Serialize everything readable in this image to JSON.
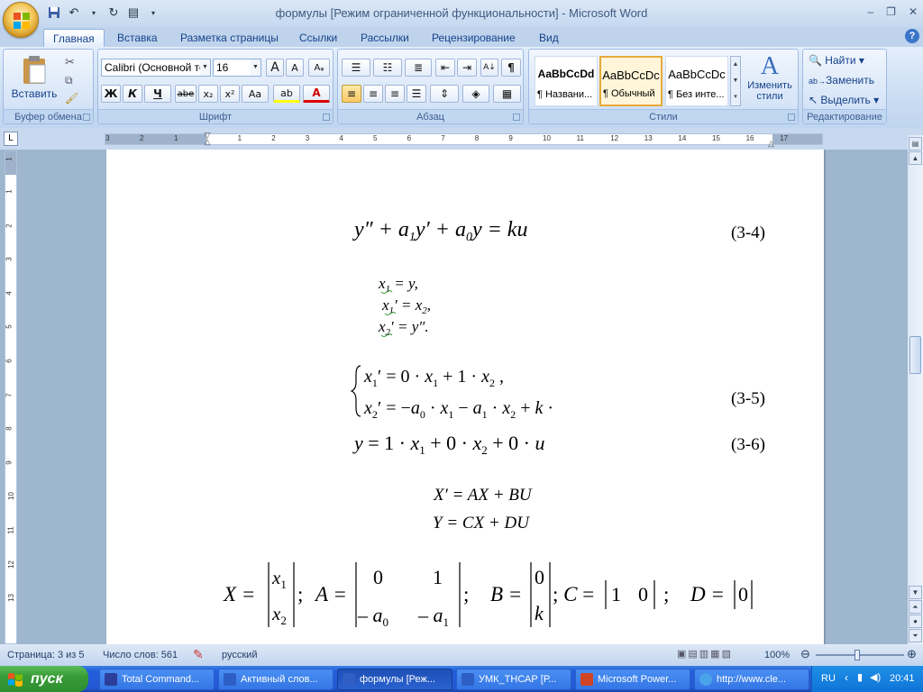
{
  "window": {
    "title": "формулы [Режим ограниченной функциональности] - Microsoft Word"
  },
  "tabs": [
    "Главная",
    "Вставка",
    "Разметка страницы",
    "Ссылки",
    "Рассылки",
    "Рецензирование",
    "Вид"
  ],
  "ribbon": {
    "clipboard": {
      "label": "Буфер обмена",
      "paste": "Вставить"
    },
    "font": {
      "label": "Шрифт",
      "name": "Calibri (Основной те",
      "size": "16",
      "bold": "Ж",
      "italic": "К",
      "underline": "Ч",
      "strike": "abe",
      "sub": "x₂",
      "sup": "x²",
      "case": "Aa",
      "grow": "A",
      "shrink": "A",
      "color": "A"
    },
    "paragraph": {
      "label": "Абзац"
    },
    "styles": {
      "label": "Стили",
      "items": [
        {
          "sample": "AaBbCcDd",
          "name": "¶ Названи..."
        },
        {
          "sample": "AaBbCcDc",
          "name": "¶ Обычный"
        },
        {
          "sample": "AaBbCcDc",
          "name": "¶ Без инте..."
        }
      ],
      "change": "Изменить стили"
    },
    "editing": {
      "label": "Редактирование",
      "find": "Найти",
      "replace": "Заменить",
      "select": "Выделить"
    }
  },
  "ruler": {
    "numbers": [
      "3",
      "2",
      "1",
      "1",
      "2",
      "3",
      "4",
      "5",
      "6",
      "7",
      "8",
      "9",
      "10",
      "11",
      "12",
      "13",
      "14",
      "15",
      "16",
      "17"
    ]
  },
  "vruler": {
    "numbers": [
      "1",
      "1",
      "2",
      "3",
      "4",
      "5",
      "6",
      "7",
      "8",
      "9",
      "10",
      "11",
      "12",
      "13"
    ]
  },
  "document": {
    "eq1": "(3-4)",
    "eq5": "(3-5)",
    "eq6": "(3-6)"
  },
  "status": {
    "page": "Страница: 3 из 5",
    "words": "Число слов: 561",
    "lang": "русский",
    "zoom": "100%"
  },
  "taskbar": {
    "start": "пуск",
    "items": [
      "Total Command...",
      "Активный слов...",
      "формулы [Реж...",
      "УМК_ТНСАР [Р...",
      "Microsoft Power...",
      "http://www.cle..."
    ],
    "lang": "RU",
    "time": "20:41"
  },
  "colors": {
    "accent": "#15428b",
    "taskbar": "#245edb",
    "start": "#379c37"
  }
}
